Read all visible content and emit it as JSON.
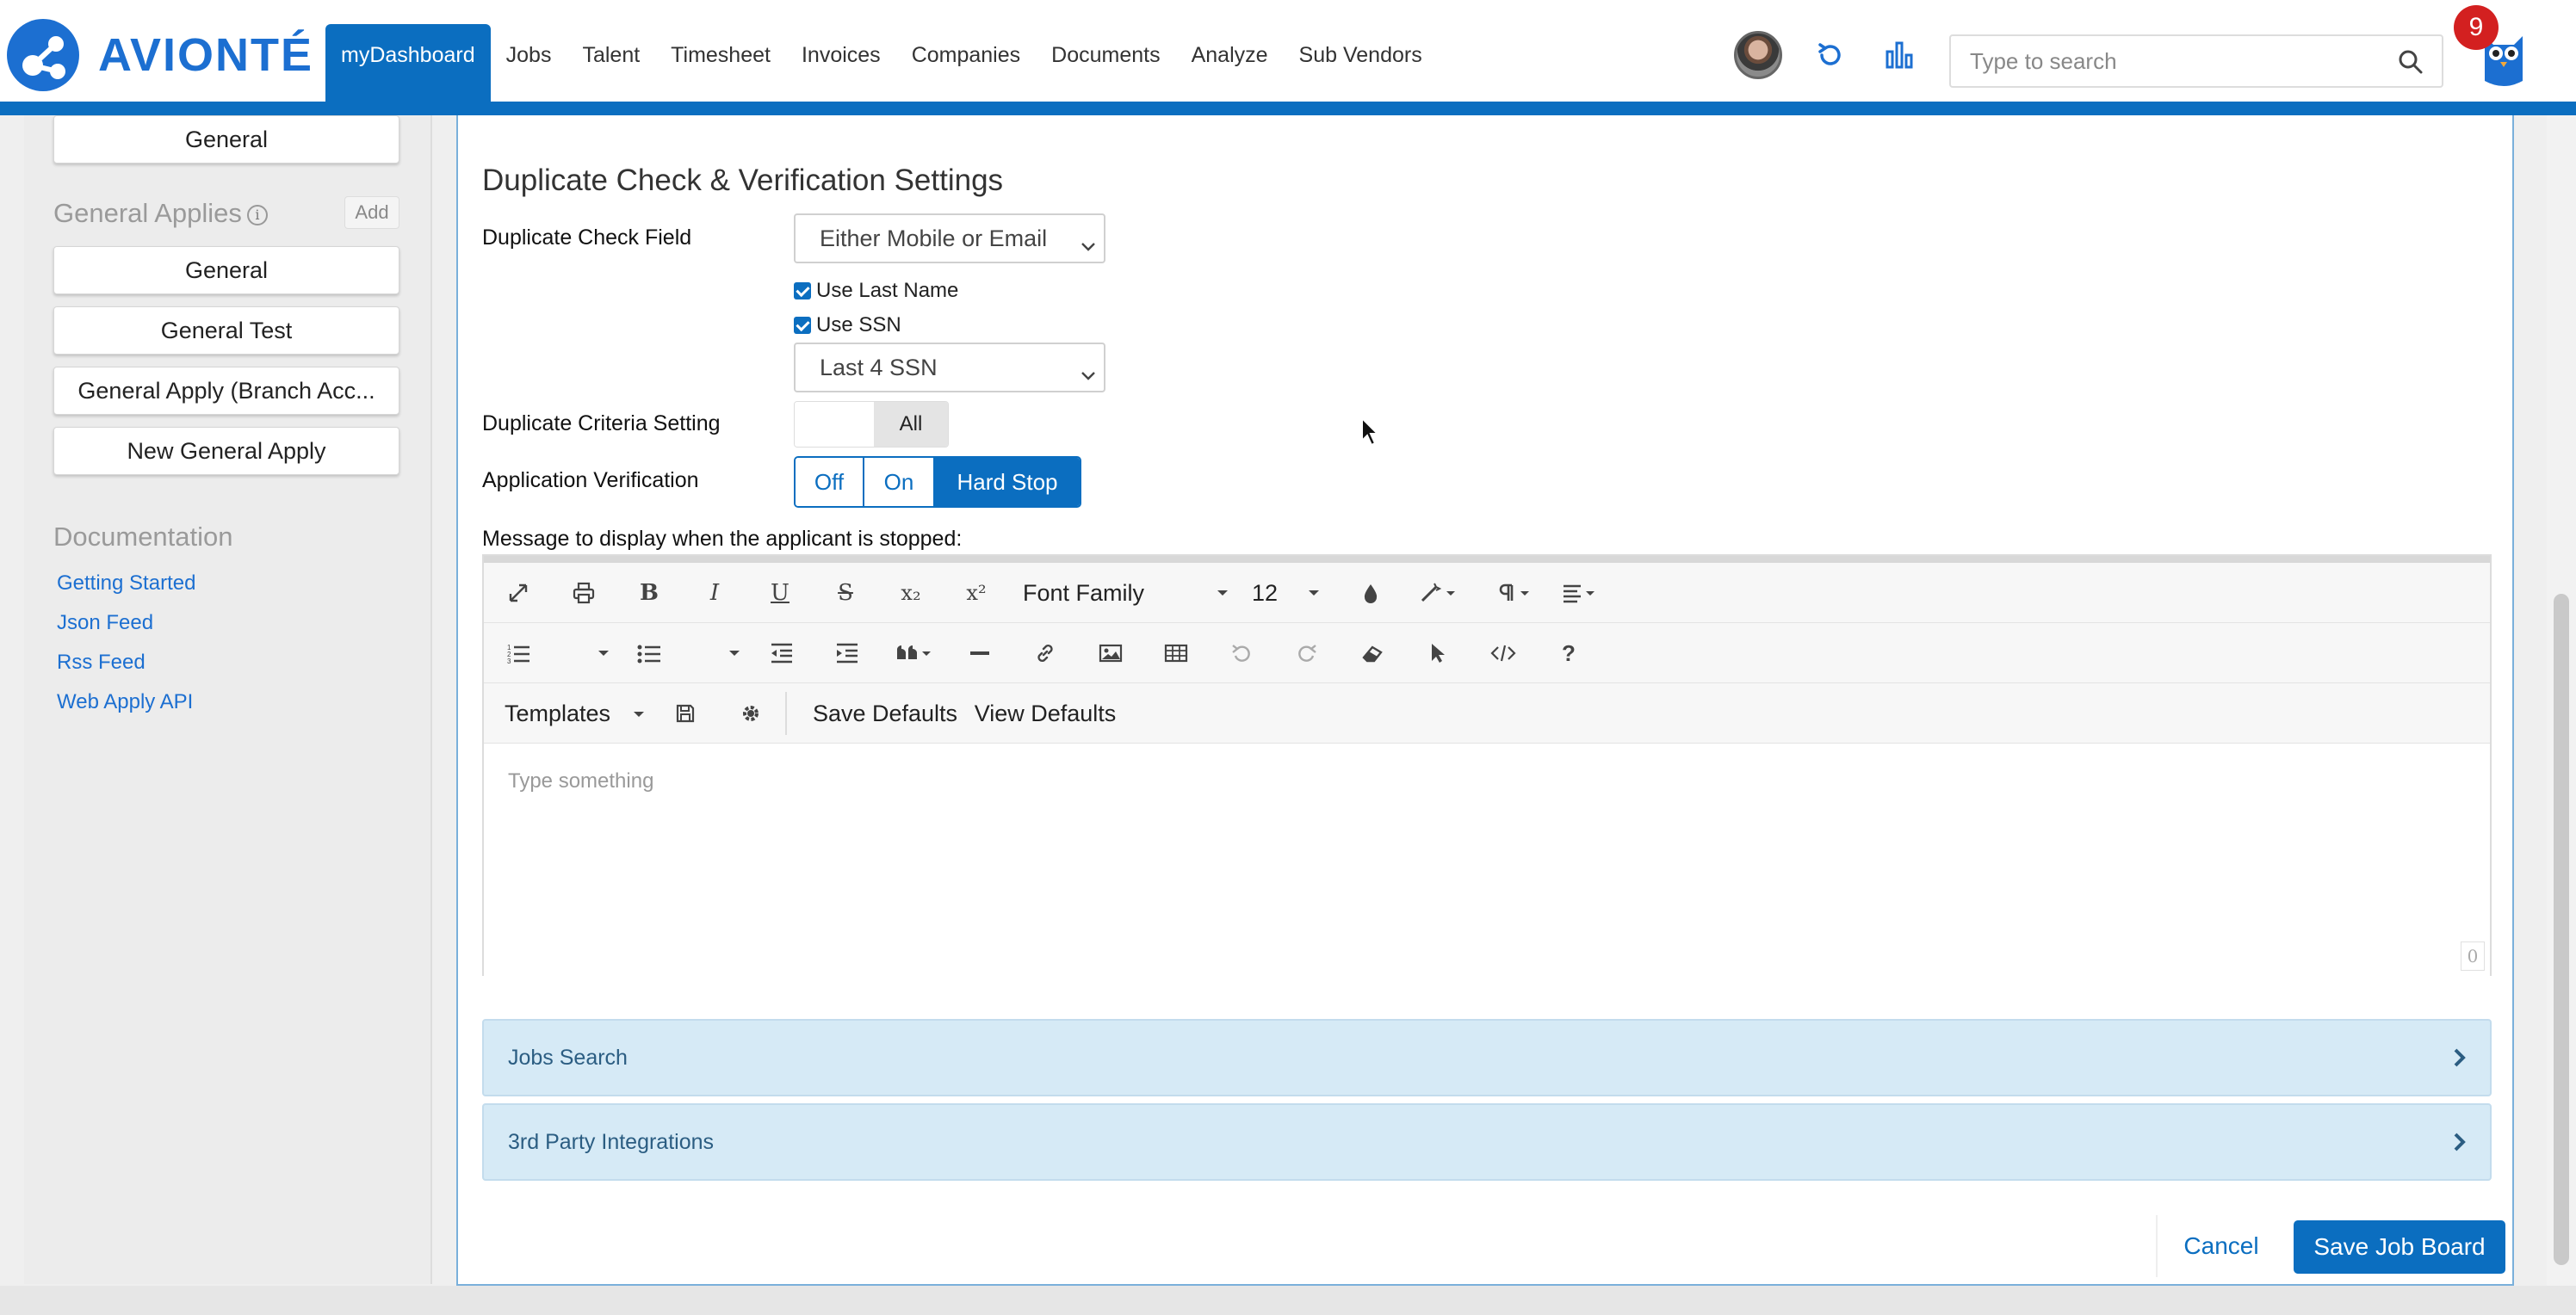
{
  "brand": {
    "name": "AVIONTÉ",
    "color": "#1c6fd1"
  },
  "nav": {
    "items": [
      {
        "label": "myDashboard",
        "active": true
      },
      {
        "label": "Jobs"
      },
      {
        "label": "Talent"
      },
      {
        "label": "Timesheet"
      },
      {
        "label": "Invoices"
      },
      {
        "label": "Companies"
      },
      {
        "label": "Documents"
      },
      {
        "label": "Analyze"
      },
      {
        "label": "Sub Vendors"
      }
    ],
    "search_placeholder": "Type to search",
    "notification_count": "9",
    "icons": [
      "user-avatar",
      "refresh-icon",
      "bar-chart-icon",
      "search-icon",
      "owl-assistant-icon"
    ]
  },
  "sidebar": {
    "top_item": "General",
    "general_applies": {
      "heading": "General Applies",
      "info_icon": "i",
      "add_label": "Add",
      "items": [
        "General",
        "General Test",
        "General Apply (Branch Acc...",
        "New General Apply"
      ]
    },
    "documentation": {
      "heading": "Documentation",
      "links": [
        "Getting Started",
        "Json Feed",
        "Rss Feed",
        "Web Apply API"
      ]
    }
  },
  "settings": {
    "title": "Duplicate Check & Verification Settings",
    "duplicate_check_field": {
      "label": "Duplicate Check Field",
      "value": "Either Mobile or Email"
    },
    "use_last_name": {
      "label": "Use Last Name",
      "checked": true
    },
    "use_ssn": {
      "label": "Use SSN",
      "checked": true
    },
    "ssn_option": {
      "value": "Last 4 SSN"
    },
    "duplicate_criteria": {
      "label": "Duplicate Criteria Setting",
      "option": "All"
    },
    "application_verification": {
      "label": "Application Verification",
      "options": [
        "Off",
        "On",
        "Hard Stop"
      ],
      "selected": "Hard Stop"
    },
    "message_label": "Message to display when the applicant is stopped:"
  },
  "editor": {
    "font_family": "Font Family",
    "font_size": "12",
    "templates_label": "Templates",
    "save_defaults": "Save Defaults",
    "view_defaults": "View Defaults",
    "placeholder": "Type something",
    "char_count": "0",
    "tools_row1": [
      "fullscreen-icon",
      "print-icon",
      "bold-icon",
      "italic-icon",
      "underline-icon",
      "strikethrough-icon",
      "subscript-icon",
      "superscript-icon",
      "font-family",
      "font-size",
      "color-drop-icon",
      "magic-wand-icon",
      "paragraph-icon",
      "align-icon"
    ],
    "tools_row2": [
      "ordered-list-icon",
      "unordered-list-icon",
      "outdent-icon",
      "indent-icon",
      "blockquote-icon",
      "horizontal-rule-icon",
      "link-icon",
      "image-icon",
      "table-icon",
      "undo-icon",
      "redo-icon",
      "eraser-icon",
      "select-icon",
      "code-view-icon",
      "help-icon"
    ],
    "glyphs": {
      "bold": "B",
      "italic": "I",
      "underline": "U",
      "strike": "S",
      "sub": "x₂",
      "sup": "x²",
      "help": "?"
    }
  },
  "accordions": [
    {
      "label": "Jobs Search"
    },
    {
      "label": "3rd Party Integrations"
    }
  ],
  "footer": {
    "cancel": "Cancel",
    "save": "Save Job Board"
  }
}
